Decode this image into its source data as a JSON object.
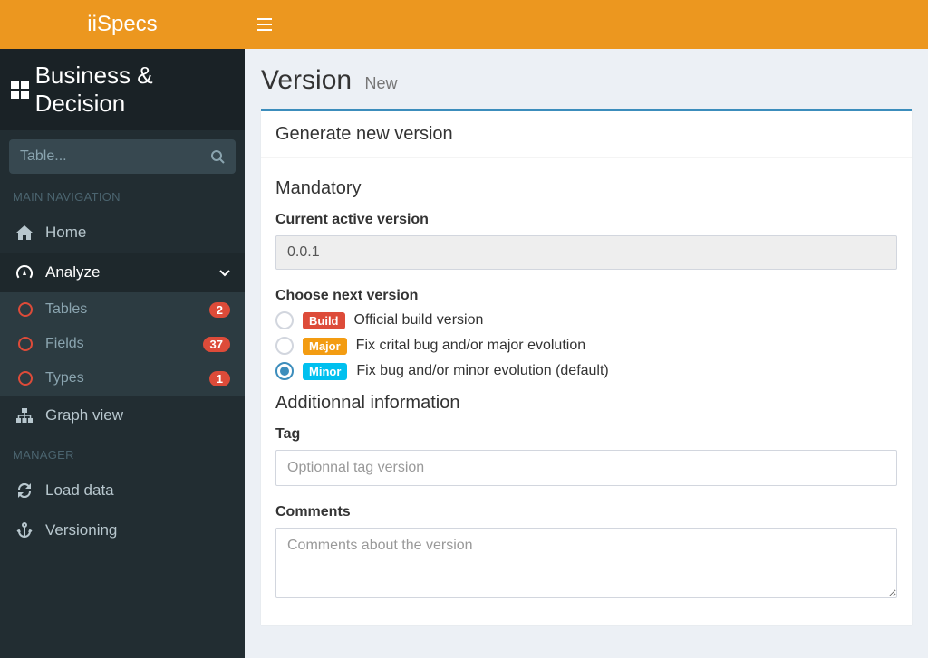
{
  "app": {
    "name": "iSpecs"
  },
  "brand": {
    "name": "Business & Decision"
  },
  "search": {
    "placeholder": "Table..."
  },
  "sidebar": {
    "sections": {
      "main": "MAIN NAVIGATION",
      "manager": "MANAGER"
    },
    "home": "Home",
    "analyze": {
      "label": "Analyze",
      "tables": {
        "label": "Tables",
        "count": "2"
      },
      "fields": {
        "label": "Fields",
        "count": "37"
      },
      "types": {
        "label": "Types",
        "count": "1"
      }
    },
    "graph": "Graph view",
    "loaddata": "Load data",
    "versioning": "Versioning"
  },
  "page": {
    "title": "Version",
    "subtitle": "New"
  },
  "panel": {
    "title": "Generate new version",
    "mandatory": "Mandatory",
    "current_label": "Current active version",
    "current_value": "0.0.1",
    "choose_label": "Choose next version",
    "options": {
      "build": {
        "badge": "Build",
        "text": "Official build version"
      },
      "major": {
        "badge": "Major",
        "text": "Fix crital bug and/or major evolution"
      },
      "minor": {
        "badge": "Minor",
        "text": "Fix bug and/or minor evolution (default)"
      }
    },
    "additional": "Additionnal information",
    "tag_label": "Tag",
    "tag_placeholder": "Optionnal tag version",
    "comments_label": "Comments",
    "comments_placeholder": "Comments about the version"
  }
}
